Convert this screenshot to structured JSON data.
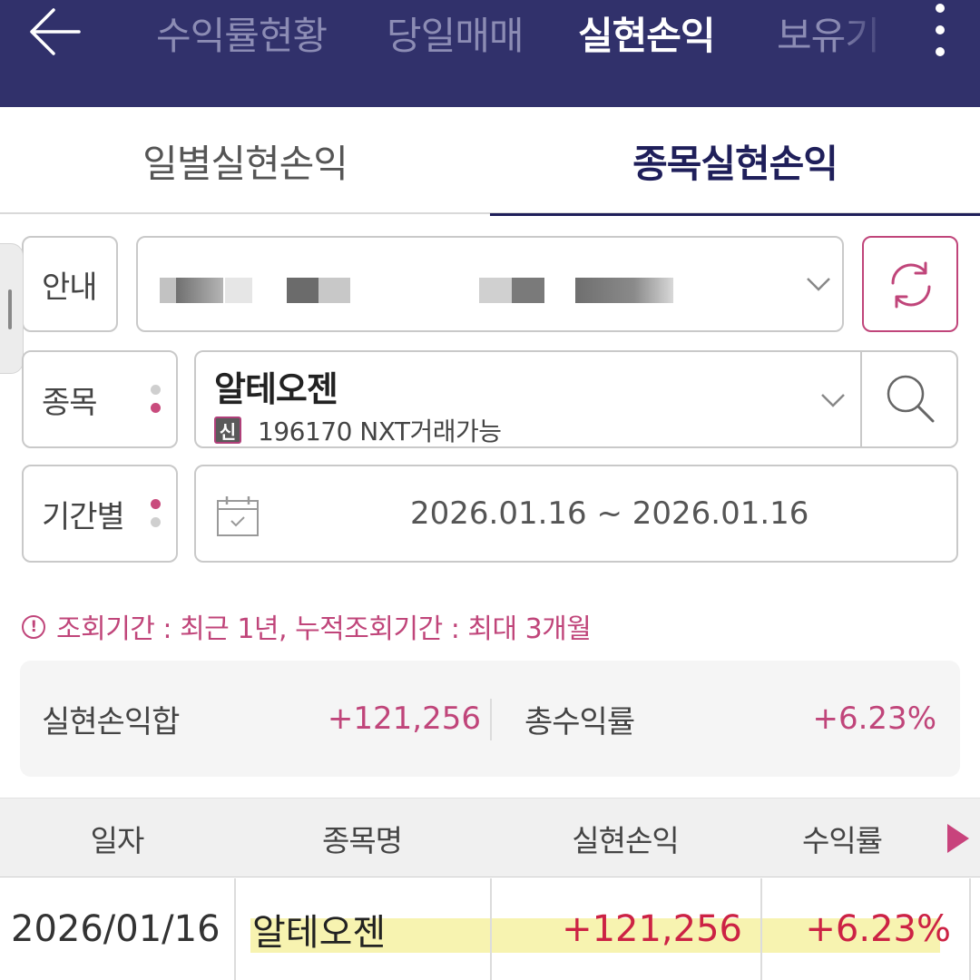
{
  "header": {
    "tabs": [
      "수익률현황",
      "당일매매",
      "실현손익",
      "보유기"
    ],
    "active_tab": "실현손익"
  },
  "sub_tabs": [
    "일별실현손익",
    "종목실현손익"
  ],
  "form": {
    "account_label": "안내",
    "stock_label": "종목",
    "stock_name": "알테오젠",
    "stock_badge": "신",
    "stock_code_line": "196170 NXT거래가능",
    "period_label": "기간별",
    "date_range": "2026.01.16 ~ 2026.01.16"
  },
  "notice": "조회기간 : 최근 1년, 누적조회기간 : 최대 3개월",
  "summary": {
    "realized_label": "실현손익합",
    "realized_value": "+121,256",
    "rate_label": "총수익률",
    "rate_value": "+6.23%"
  },
  "table": {
    "headers": [
      "일자",
      "종목명",
      "실현손익",
      "수익률"
    ],
    "rows": [
      {
        "date": "2026/01/16",
        "name": "알테오젠",
        "profit": "+121,256",
        "rate": "+6.23%"
      }
    ]
  },
  "colors": {
    "header_bg": "#31316b",
    "accent": "#c0457a",
    "positive": "#cc2244",
    "highlight": "#f7f3b0"
  }
}
